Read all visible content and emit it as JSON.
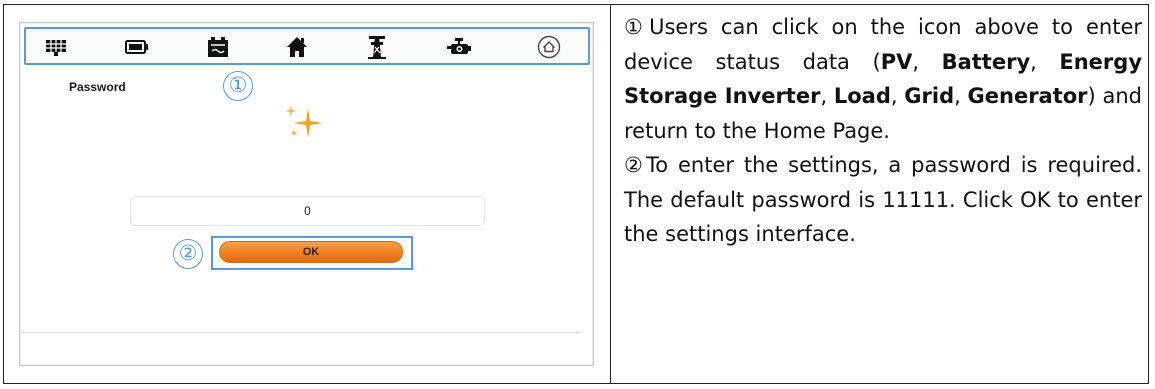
{
  "screen": {
    "icon_bar": {
      "icons": [
        "grid-icon",
        "battery-icon",
        "inverter-icon",
        "house-icon",
        "pylon-icon",
        "generator-icon",
        "home-circle-icon"
      ]
    },
    "password_label": "Password",
    "marker_1": "①",
    "marker_2": "②",
    "password_value": "0",
    "ok_label": "OK",
    "colors": {
      "highlight": "#5b9bd5",
      "ok_button": "#ee7b1a",
      "sparkle": "#f0a020"
    }
  },
  "description": {
    "p1": {
      "marker": "①",
      "t1": "Users can click on the icon above to enter device status data (",
      "b1": "PV",
      "t2": ", ",
      "b2": "Battery",
      "t3": ", ",
      "b3": "Energy Storage Inverter",
      "t4": ", ",
      "b4": "Load",
      "t5": ", ",
      "b5": "Grid",
      "t6": ", ",
      "b6": "Generator",
      "t7": ") and return to the Home Page."
    },
    "p2": {
      "marker": "②",
      "text": "To enter the settings, a password is required. The default password is 11111. Click OK to enter the settings interface."
    }
  }
}
